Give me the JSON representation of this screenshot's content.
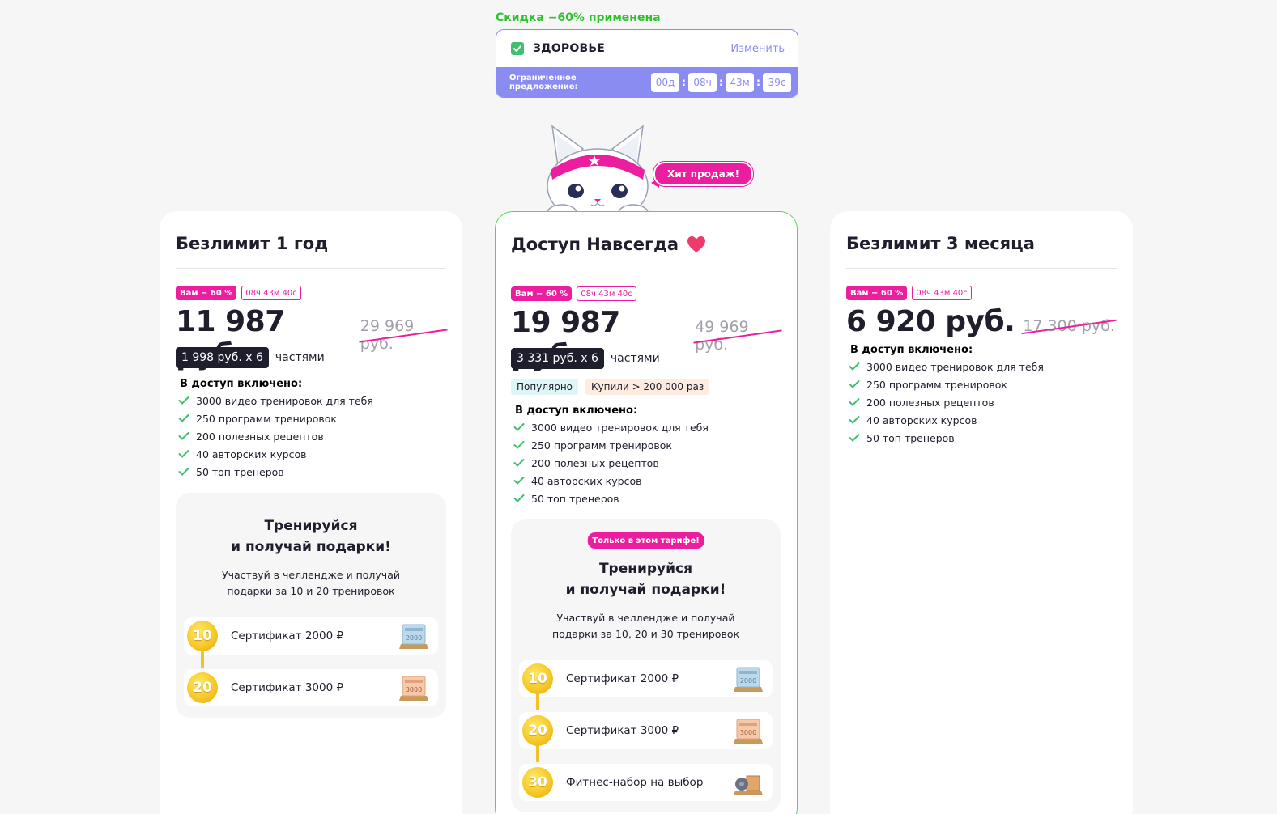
{
  "promo": {
    "note": "Скидка −60% применена",
    "name": "ЗДОРОВЬЕ",
    "change": "Изменить",
    "limited": "Ограниченное предложение:",
    "timer": [
      "00д",
      "08ч",
      "43м",
      "39с"
    ]
  },
  "hit": "Хит продаж!",
  "colors": {
    "pink": "#ec1ea0",
    "green": "#5ad25a",
    "violet": "#8b8cf2",
    "dark": "#1e1e2d",
    "gold": "#f6c928"
  },
  "cards": [
    {
      "title": "Безлимит 1 год",
      "discount": "Вам − 60 %",
      "timer": "08ч 43м 40с",
      "price": "11 987 руб.",
      "old_price": "29 969 руб.",
      "parts": "1 998 руб. x 6",
      "parts_label": "частями",
      "included_title": "В доступ включено:",
      "features": [
        "3000 видео тренировок для тебя",
        "250 программ тренировок",
        "200 полезных рецептов",
        "40 авторских курсов",
        "50 топ тренеров"
      ],
      "gifts": {
        "title1": "Тренируйся",
        "title2": "и получай подарки!",
        "desc1": "Участвуй в челлендже и получай",
        "desc2": "подарки за 10 и 20 тренировок",
        "items": [
          {
            "num": "10",
            "name": "Сертификат 2000 ₽",
            "icon": "certificate-2000-icon"
          },
          {
            "num": "20",
            "name": "Сертификат 3000 ₽",
            "icon": "certificate-3000-icon"
          }
        ]
      }
    },
    {
      "title": "Доступ Навсегда",
      "discount": "Вам − 60 %",
      "timer": "08ч 43м 40с",
      "price": "19 987 руб.",
      "old_price": "49 969 руб.",
      "parts": "3 331 руб. x 6",
      "parts_label": "частями",
      "tag_popular": "Популярно",
      "tag_bought": "Купили > 200 000 раз",
      "included_title": "В доступ включено:",
      "features": [
        "3000 видео тренировок для тебя",
        "250 программ тренировок",
        "200 полезных рецептов",
        "40 авторских курсов",
        "50 топ тренеров"
      ],
      "gifts": {
        "badge": "Только в этом тарифе!",
        "title1": "Тренируйся",
        "title2": "и получай подарки!",
        "desc1": "Участвуй в челлендже и получай",
        "desc2": "подарки за 10, 20 и 30 тренировок",
        "items": [
          {
            "num": "10",
            "name": "Сертификат 2000 ₽",
            "icon": "certificate-2000-icon"
          },
          {
            "num": "20",
            "name": "Сертификат 3000 ₽",
            "icon": "certificate-3000-icon"
          },
          {
            "num": "30",
            "name": "Фитнес-набор на выбор",
            "icon": "fitness-kit-icon"
          }
        ]
      }
    },
    {
      "title": "Безлимит 3 месяца",
      "discount": "Вам − 60 %",
      "timer": "08ч 43м 40с",
      "price": "6 920 руб.",
      "old_price": "17 300 руб.",
      "included_title": "В доступ включено:",
      "features": [
        "3000 видео тренировок для тебя",
        "250 программ тренировок",
        "200 полезных рецептов",
        "40 авторских курсов",
        "50 топ тренеров"
      ]
    }
  ]
}
